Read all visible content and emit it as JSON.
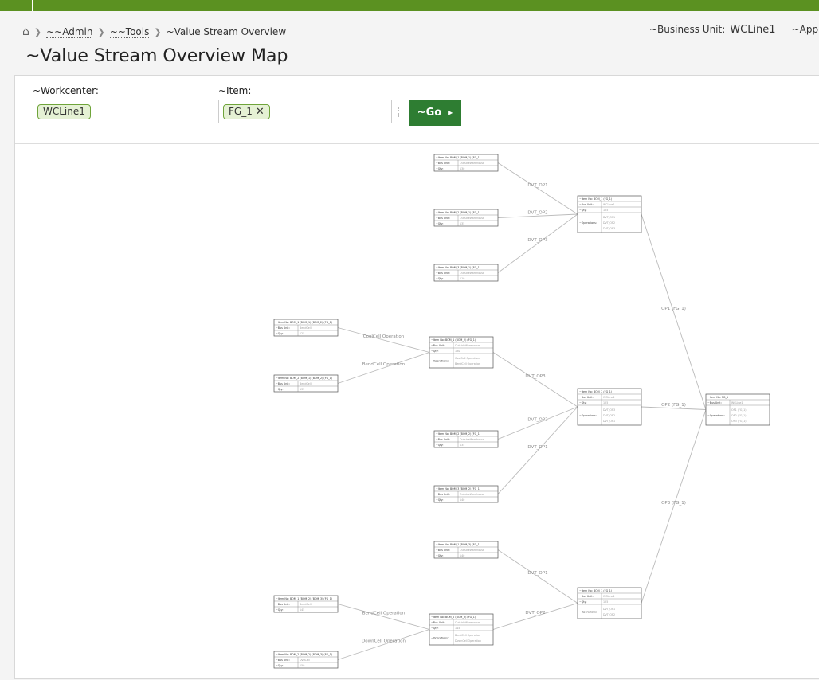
{
  "breadcrumb": {
    "admin": "~~Admin",
    "tools": "~~Tools",
    "current": "~Value Stream Overview"
  },
  "business_unit": {
    "label": "~Business Unit:",
    "value": "WCLine1",
    "app": "~App"
  },
  "page_title": "~Value Stream Overview Map",
  "filters": {
    "workcenter_label": "~Workcenter:",
    "workcenter_value": "WCLine1",
    "item_label": "~Item:",
    "item_value": "FG_1",
    "go_label": "~Go"
  },
  "colors": {
    "accent": "#5b9121",
    "go_button": "#2e7d32",
    "chip_bg": "#e5f1d4",
    "edge": "#bbbbbb"
  },
  "map": {
    "nodes": [
      {
        "id": "n1",
        "rows": [
          [
            "~Item No: BOM_1 (BOM_1) (FG_1)",
            ""
          ],
          [
            "~Bus Unit:",
            "OutsideWarehouse"
          ],
          [
            "~Qty:",
            "130"
          ]
        ]
      },
      {
        "id": "n2",
        "rows": [
          [
            "~Item No: BOM_2 (BOM_1) (FG_1)",
            ""
          ],
          [
            "~Bus Unit:",
            "OutsideWarehouse"
          ],
          [
            "~Qty:",
            "135"
          ]
        ]
      },
      {
        "id": "n3",
        "rows": [
          [
            "~Item No: BOM_3 (BOM_1) (FG_1)",
            ""
          ],
          [
            "~Bus Unit:",
            "OutsideWarehouse"
          ],
          [
            "~Qty:",
            "110"
          ]
        ]
      },
      {
        "id": "n4",
        "rows": [
          [
            "~Item No: BOM_1 (FG_1)",
            ""
          ],
          [
            "~Bus Unit:",
            "WCLine1"
          ],
          [
            "~Qty:",
            "125"
          ]
        ],
        "ops_label": "~Operations:",
        "ops": [
          "DVT_OP1",
          "DVT_OP2",
          "DVT_OP3"
        ]
      },
      {
        "id": "n5",
        "rows": [
          [
            "~Item No: BOM_1 (BOM_1) (BOM_2) (FG_1)",
            ""
          ],
          [
            "~Bus Unit:",
            "BendCell"
          ],
          [
            "~Qty:",
            "125"
          ]
        ]
      },
      {
        "id": "n6",
        "rows": [
          [
            "~Item No: BOM_2 (BOM_1) (BOM_2) (FG_1)",
            ""
          ],
          [
            "~Bus Unit:",
            "BendCell"
          ],
          [
            "~Qty:",
            "135"
          ]
        ]
      },
      {
        "id": "n7",
        "rows": [
          [
            "~Item No: BOM_1 (BOM_2) (FG_1)",
            ""
          ],
          [
            "~Bus Unit:",
            "OutsideWarehouse"
          ],
          [
            "~Qty:",
            "130"
          ]
        ],
        "ops_label": "~Operations:",
        "ops": [
          "CoolCell Operation",
          "BendCell Operation"
        ]
      },
      {
        "id": "n8",
        "rows": [
          [
            "~Item No: BOM_2 (FG_1)",
            ""
          ],
          [
            "~Bus Unit:",
            "WCLine1"
          ],
          [
            "~Qty:",
            "125"
          ]
        ],
        "ops_label": "~Operations:",
        "ops": [
          "DVT_OP3",
          "DVT_OP2",
          "DVT_OP1"
        ]
      },
      {
        "id": "n9",
        "rows": [
          [
            "~Item No: BOM_2 (BOM_2) (FG_1)",
            ""
          ],
          [
            "~Bus Unit:",
            "OutsideWarehouse"
          ],
          [
            "~Qty:",
            "135"
          ]
        ]
      },
      {
        "id": "n10",
        "rows": [
          [
            "~Item No: BOM_3 (BOM_2) (FG_1)",
            ""
          ],
          [
            "~Bus Unit:",
            "OutsideWarehouse"
          ],
          [
            "~Qty:",
            "140"
          ]
        ]
      },
      {
        "id": "n11",
        "rows": [
          [
            "~Item No: FG_1",
            ""
          ],
          [
            "~Bus Unit:",
            "WCLine1"
          ]
        ],
        "ops_label": "~Operations:",
        "ops": [
          "OP1 (FG_1)",
          "OP2 (FG_1)",
          "OP3 (FG_1)"
        ]
      },
      {
        "id": "n12",
        "rows": [
          [
            "~Item No: BOM_1 (BOM_3) (FG_1)",
            ""
          ],
          [
            "~Bus Unit:",
            "OutsideWarehouse"
          ],
          [
            "~Qty:",
            "140"
          ]
        ]
      },
      {
        "id": "n13",
        "rows": [
          [
            "~Item No: BOM_3 (FG_1)",
            ""
          ],
          [
            "~Bus Unit:",
            "WCLine1"
          ],
          [
            "~Qty:",
            "125"
          ]
        ],
        "ops_label": "~Operations:",
        "ops": [
          "DVT_OP1",
          "DVT_OP2"
        ]
      },
      {
        "id": "n14",
        "rows": [
          [
            "~Item No: BOM_1 (BOM_2) (BOM_3) (FG_1)",
            ""
          ],
          [
            "~Bus Unit:",
            "BendCell"
          ],
          [
            "~Qty:",
            "145"
          ]
        ]
      },
      {
        "id": "n15",
        "rows": [
          [
            "~Item No: BOM_2 (BOM_3) (FG_1)",
            ""
          ],
          [
            "~Bus Unit:",
            "OutsideWarehouse"
          ],
          [
            "~Qty:",
            "145"
          ]
        ],
        "ops_label": "~Operations:",
        "ops": [
          "BendCell Operation",
          "DownCell Operation"
        ]
      },
      {
        "id": "n16",
        "rows": [
          [
            "~Item No: BOM_2 (BOM_2) (BOM_3) (FG_1)",
            ""
          ],
          [
            "~Bus Unit:",
            "DvdCell"
          ],
          [
            "~Qty:",
            "150"
          ]
        ]
      }
    ],
    "edges": [
      {
        "from": "n1",
        "to": "n4",
        "label": "DVT_OP1"
      },
      {
        "from": "n2",
        "to": "n4",
        "label": "DVT_OP2"
      },
      {
        "from": "n3",
        "to": "n4",
        "label": "DVT_OP3"
      },
      {
        "from": "n5",
        "to": "n7",
        "label": "CoolCell Operation"
      },
      {
        "from": "n6",
        "to": "n7",
        "label": "BendCell Operation"
      },
      {
        "from": "n7",
        "to": "n8",
        "label": "DVT_OP3"
      },
      {
        "from": "n9",
        "to": "n8",
        "label": "DVT_OP2"
      },
      {
        "from": "n10",
        "to": "n8",
        "label": "DVT_OP1"
      },
      {
        "from": "n4",
        "to": "n11",
        "label": "OP1 (FG_1)"
      },
      {
        "from": "n8",
        "to": "n11",
        "label": "OP2 (FG_1)"
      },
      {
        "from": "n13",
        "to": "n11",
        "label": "OP3 (FG_1)"
      },
      {
        "from": "n12",
        "to": "n13",
        "label": "DVT_OP1"
      },
      {
        "from": "n15",
        "to": "n13",
        "label": "DVT_OP2"
      },
      {
        "from": "n14",
        "to": "n15",
        "label": "BendCell Operation"
      },
      {
        "from": "n16",
        "to": "n15",
        "label": "DownCell Operation"
      }
    ]
  }
}
